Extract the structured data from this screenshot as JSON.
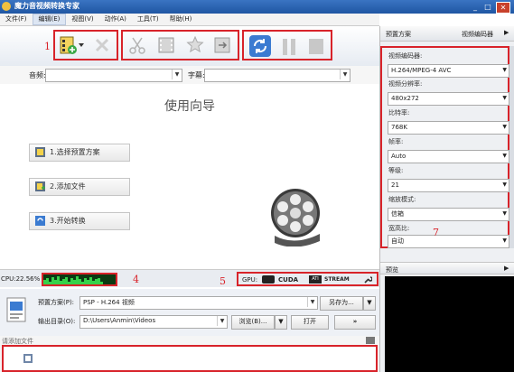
{
  "window": {
    "title": "魔力音视频转换专家",
    "minimize": "_",
    "maximize": "□",
    "close": "✕"
  },
  "menu": [
    "文件(F)",
    "编辑(E)",
    "视图(V)",
    "动作(A)",
    "工具(T)",
    "帮助(H)"
  ],
  "annotations": {
    "n1": "1",
    "n2": "2",
    "n3": "3",
    "n4": "4",
    "n5": "5",
    "n6": "6",
    "n7": "7"
  },
  "filters": {
    "audio_label": "音频:",
    "subtitle_label": "字幕:"
  },
  "wizard": {
    "title": "使用向导",
    "steps": [
      "1.选择预置方案",
      "2.添加文件",
      "3.开始转换"
    ]
  },
  "status": {
    "cpu": "CPU:22.56%",
    "gpu_label": "GPU:",
    "cuda": "CUDA",
    "stream": "STREAM",
    "ati": "ATI"
  },
  "output": {
    "preset_label": "预置方案(P):",
    "preset_value": "PSP - H.264 视频",
    "save_as": "另存为...",
    "dir_label": "输出目录(O):",
    "dir_value": "D:\\Users\\Anmin\\Videos",
    "browse": "浏览(B)...",
    "open": "打开",
    "go": "»"
  },
  "queue": {
    "label": "请添加文件"
  },
  "right": {
    "header": "预置方案",
    "encoder_tab": "视频编码器",
    "fields": [
      {
        "label": "视频编码器:",
        "value": "H.264/MPEG-4 AVC"
      },
      {
        "label": "视频分辨率:",
        "value": "480x272"
      },
      {
        "label": "比特率:",
        "value": "768K"
      },
      {
        "label": "帧率:",
        "value": "Auto"
      },
      {
        "label": "等级:",
        "value": "21"
      },
      {
        "label": "缩放模式:",
        "value": "信箱"
      },
      {
        "label": "宽高比:",
        "value": "自动"
      }
    ],
    "preview_header": "预览"
  },
  "colors": {
    "annotation": "#d8232a",
    "title_bar": "#2a62b0",
    "convert_blue": "#3b7bd1"
  }
}
